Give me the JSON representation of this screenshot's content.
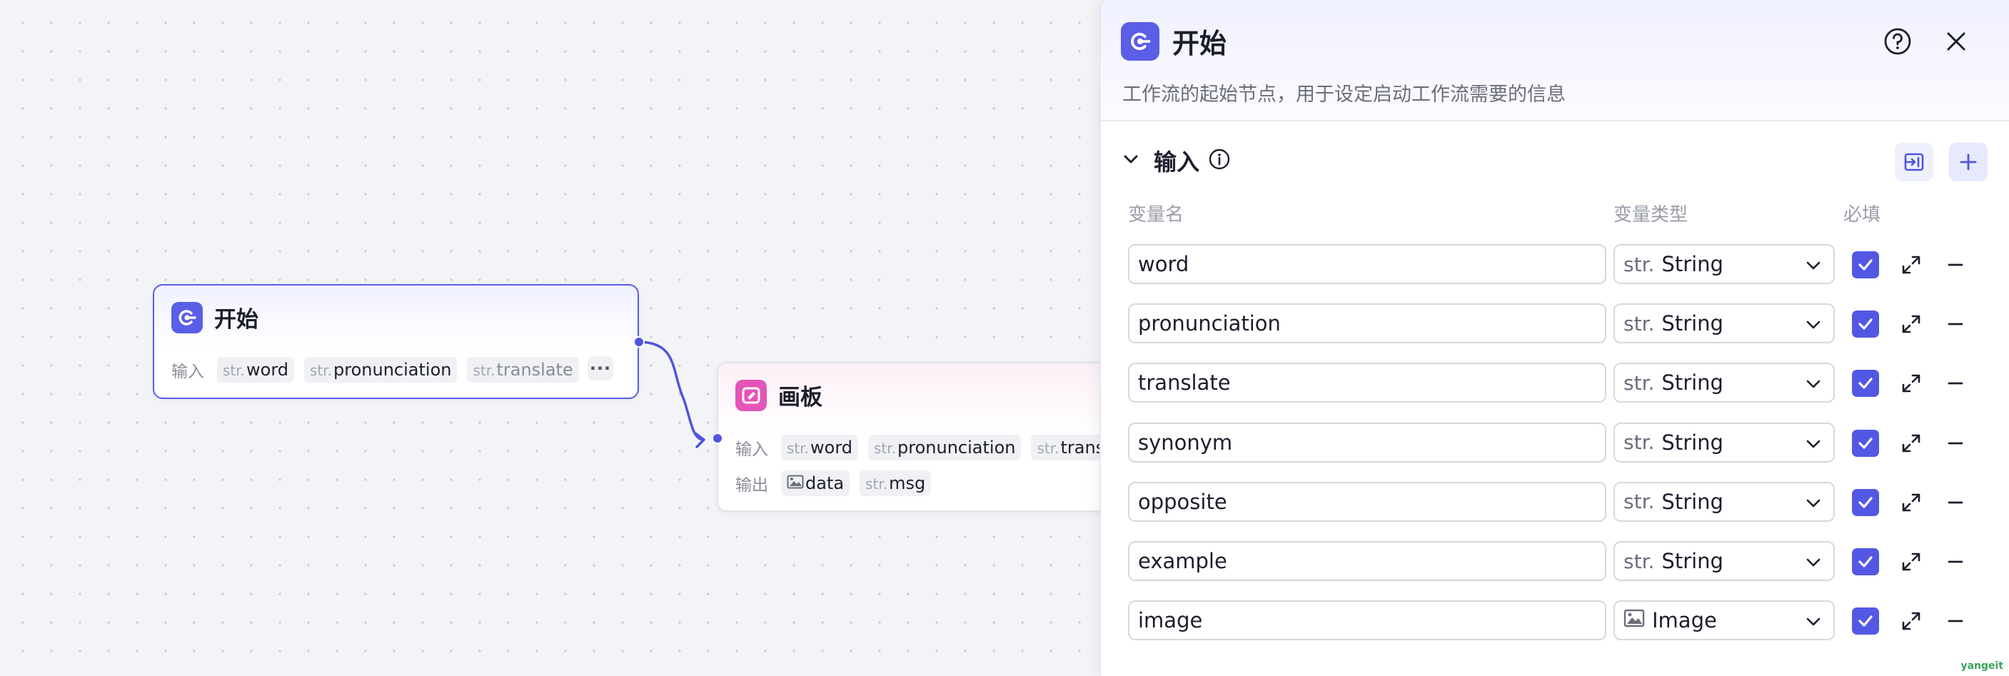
{
  "nodes": {
    "start": {
      "title": "开始",
      "input_label": "输入",
      "inputs": [
        {
          "prefix": "str.",
          "name": "word"
        },
        {
          "prefix": "str.",
          "name": "pronunciation"
        },
        {
          "prefix": "str.",
          "name": "translate"
        }
      ],
      "more": "···"
    },
    "canvas": {
      "title": "画板",
      "input_label": "输入",
      "output_label": "输出",
      "inputs": [
        {
          "prefix": "str.",
          "name": "word"
        },
        {
          "prefix": "str.",
          "name": "pronunciation"
        },
        {
          "prefix": "str.",
          "name": "translate"
        }
      ],
      "outputs": [
        {
          "prefix": "",
          "name": "data",
          "icon": "image-icon"
        },
        {
          "prefix": "str.",
          "name": "msg"
        }
      ]
    }
  },
  "panel": {
    "title": "开始",
    "description": "工作流的起始节点，用于设定启动工作流需要的信息",
    "section_title": "输入",
    "columns": {
      "name": "变量名",
      "type": "变量类型",
      "required": "必填"
    },
    "variables": [
      {
        "name": "word",
        "type_prefix": "str.",
        "type": "String",
        "required": true
      },
      {
        "name": "pronunciation",
        "type_prefix": "str.",
        "type": "String",
        "required": true
      },
      {
        "name": "translate",
        "type_prefix": "str.",
        "type": "String",
        "required": true
      },
      {
        "name": "synonym",
        "type_prefix": "str.",
        "type": "String",
        "required": true
      },
      {
        "name": "opposite",
        "type_prefix": "str.",
        "type": "String",
        "required": true
      },
      {
        "name": "example",
        "type_prefix": "str.",
        "type": "String",
        "required": true
      },
      {
        "name": "image",
        "type_prefix": "",
        "type": "Image",
        "type_icon": "image-icon",
        "required": true
      }
    ]
  },
  "watermark": "yangeit",
  "colors": {
    "accent": "#5b5ee6",
    "board": "#e554b8",
    "edge": "#4f55dd"
  }
}
